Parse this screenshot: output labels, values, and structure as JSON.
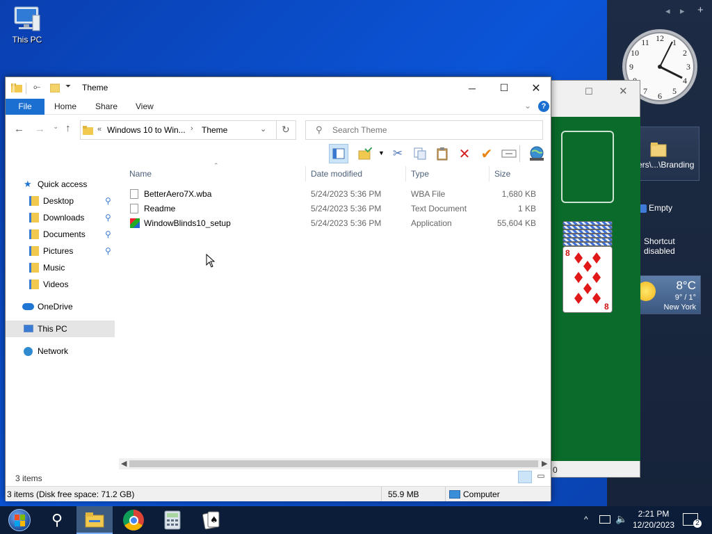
{
  "desktop": {
    "this_pc_label": "This PC"
  },
  "sidebar": {
    "branding_label": "ers\\...\\Branding",
    "recycle_label": "Empty",
    "shortcut_label_1": "Shortcut",
    "shortcut_label_2": "disabled",
    "weather": {
      "temp": "8°C",
      "range": "9° / 1°",
      "city": "New York"
    }
  },
  "solitaire": {
    "score": "0"
  },
  "explorer": {
    "title": "Theme",
    "ribbon_tabs": [
      "File",
      "Home",
      "Share",
      "View"
    ],
    "breadcrumb": {
      "overflow": "«",
      "parent": "Windows 10 to Win...",
      "current": "Theme"
    },
    "search_placeholder": "Search Theme",
    "columns": {
      "name": "Name",
      "date": "Date modified",
      "type": "Type",
      "size": "Size"
    },
    "files": [
      {
        "name": "BetterAero7X.wba",
        "date": "5/24/2023 5:36 PM",
        "type": "WBA File",
        "size": "1,680 KB"
      },
      {
        "name": "Readme",
        "date": "5/24/2023 5:36 PM",
        "type": "Text Document",
        "size": "1 KB"
      },
      {
        "name": "WindowBlinds10_setup",
        "date": "5/24/2023 5:36 PM",
        "type": "Application",
        "size": "55,604 KB"
      }
    ],
    "nav": {
      "quick_access": "Quick access",
      "desktop": "Desktop",
      "downloads": "Downloads",
      "documents": "Documents",
      "pictures": "Pictures",
      "music": "Music",
      "videos": "Videos",
      "onedrive": "OneDrive",
      "this_pc": "This PC",
      "network": "Network"
    },
    "item_count": "3 items",
    "status": {
      "summary": "3 items (Disk free space: 71.2 GB)",
      "size": "55.9 MB",
      "location": "Computer"
    }
  },
  "taskbar": {
    "time": "2:21 PM",
    "date": "12/20/2023",
    "notifications": "2"
  }
}
